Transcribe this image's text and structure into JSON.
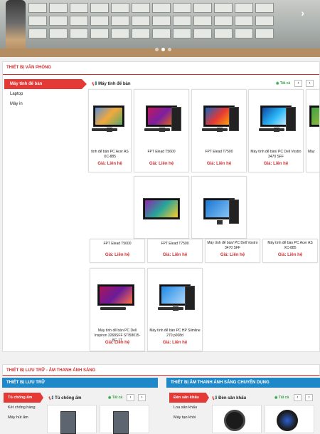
{
  "banner": {
    "next_icon": "chevron-right-icon",
    "slides": 3,
    "active_slide": 1
  },
  "office": {
    "section_title": "THIẾT BỊ VĂN PHÒNG",
    "sidebar": [
      {
        "label": "Máy tính để bàn",
        "active": true
      },
      {
        "label": "Laptop",
        "active": false
      },
      {
        "label": "Máy in",
        "active": false
      }
    ],
    "products_title": "Máy tính để bàn",
    "all_label": "Tất cả",
    "prev_label": "‹",
    "next_label": "›",
    "row1": [
      {
        "name": "tính để bàn PC Acer AS XC-885",
        "price": "Giá: Liên hệ"
      },
      {
        "name": "FPT Elead T5600",
        "price": "Giá: Liên hệ"
      },
      {
        "name": "FPT Elead T7500",
        "price": "Giá: Liên hệ"
      },
      {
        "name": "Máy tính để bàn/ PC Dell Vostro 3470 SFF",
        "price": "Giá: Liên hệ"
      },
      {
        "name": "Máy",
        "price": ""
      }
    ],
    "row2": [
      {
        "name": "FPT Elead T5600",
        "price": "Giá: Liên hệ"
      },
      {
        "name": "FPT Elead T7500",
        "price": "Giá: Liên hệ"
      },
      {
        "name": "Máy tính để bàn/ PC Dell Vostro 3470 SFF",
        "price": "Giá: Liên hệ"
      },
      {
        "name": "Máy tính để bàn PC Acer AS XC-885",
        "price": "Giá: Liên hệ"
      }
    ],
    "row3": [
      {
        "name": "Máy tính để bàn PC Dell Inspiron 3268SFF STI58015-8G-1T",
        "price": "Giá: Liên hệ"
      },
      {
        "name": "Máy tính để bàn PC HP Slimline 270 p008d",
        "price": "Giá: Liên hệ"
      }
    ]
  },
  "storage": {
    "section_title": "THIẾT BỊ LƯU TRỮ - ÂM THANH ÁNH SÁNG",
    "left": {
      "bar_title": "THIẾT BỊ LƯU TRỮ",
      "sidebar": [
        {
          "label": "Tủ chống ẩm",
          "active": true
        },
        {
          "label": "Két chống hàng",
          "active": false
        },
        {
          "label": "Máy hút ẩm",
          "active": false
        }
      ],
      "products_title": "Tủ chống ẩm",
      "all_label": "Tất cả"
    },
    "right": {
      "bar_title": "THIẾT BỊ ÂM THANH ÁNH SÁNG CHUYÊN DỤNG",
      "sidebar": [
        {
          "label": "Đèn sân khấu",
          "active": true
        },
        {
          "label": "Loa sân khấu",
          "active": false
        },
        {
          "label": "Máy tạo khói",
          "active": false
        }
      ],
      "products_title": "Đèn sân khấu",
      "all_label": "Tất cả"
    }
  },
  "colors": {
    "accent_red": "#d32f2f",
    "blue": "#1e88c8",
    "green": "#3aa34b"
  }
}
